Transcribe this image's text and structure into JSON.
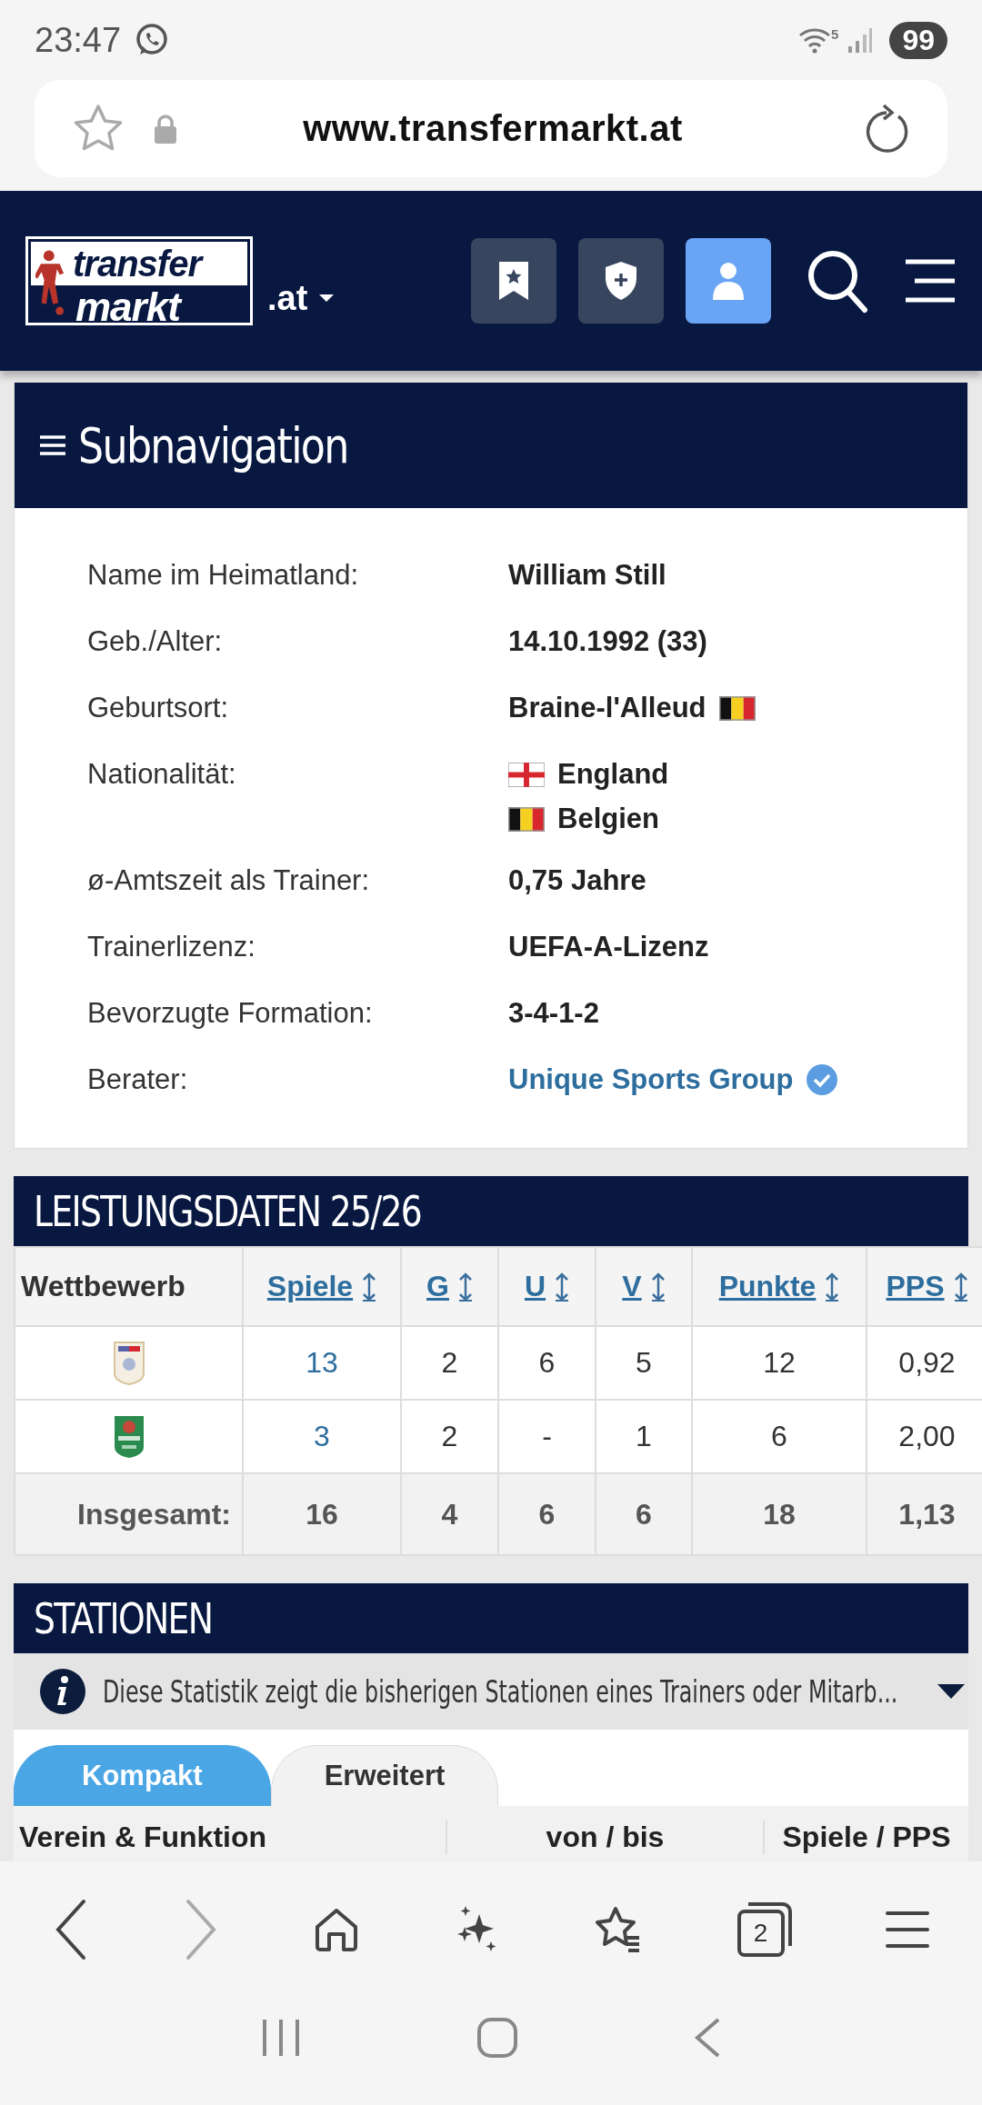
{
  "status_bar": {
    "time": "23:47",
    "wifi_badge": "5",
    "battery": "99"
  },
  "browser": {
    "url": "www.transfermarkt.at"
  },
  "site_header": {
    "logo_top": "transfer",
    "logo_bottom": "markt",
    "domain": ".at",
    "buttons": [
      {
        "kind": "bookmark",
        "active": false
      },
      {
        "kind": "shield",
        "active": false
      },
      {
        "kind": "user",
        "active": true
      }
    ]
  },
  "subnavigation": {
    "title": "Subnavigation"
  },
  "details": [
    {
      "label": "Name im Heimatland:",
      "values": [
        {
          "kind": "plain",
          "text": "William Still"
        }
      ]
    },
    {
      "label": "Geb./Alter:",
      "values": [
        {
          "kind": "plain",
          "text": "14.10.1992 (33)"
        }
      ]
    },
    {
      "label": "Geburtsort:",
      "values": [
        {
          "kind": "belgium_flag_after",
          "text": "Braine-l'Alleud"
        }
      ]
    },
    {
      "label": "Nationalität:",
      "values": [
        {
          "kind": "england_flag_before",
          "text": "England"
        },
        {
          "kind": "belgium_flag_before",
          "text": "Belgien"
        }
      ]
    },
    {
      "label": "ø-Amtszeit als Trainer:",
      "values": [
        {
          "kind": "plain",
          "text": "0,75 Jahre"
        }
      ]
    },
    {
      "label": "Trainerlizenz:",
      "values": [
        {
          "kind": "plain",
          "text": "UEFA-A-Lizenz"
        }
      ]
    },
    {
      "label": "Bevorzugte Formation:",
      "values": [
        {
          "kind": "plain",
          "text": "3-4-1-2"
        }
      ]
    },
    {
      "label": "Berater:",
      "values": [
        {
          "kind": "link",
          "text": "Unique Sports Group",
          "verified": true
        }
      ]
    }
  ],
  "performance": {
    "title": "LEISTUNGSDATEN 25/26",
    "columns": [
      {
        "label": "Wettbewerb",
        "sortable": false
      },
      {
        "label": "Spiele",
        "sortable": true,
        "linked": true
      },
      {
        "label": "G",
        "sortable": true,
        "linked": false
      },
      {
        "label": "U",
        "sortable": true,
        "linked": false
      },
      {
        "label": "V",
        "sortable": true,
        "linked": false
      },
      {
        "label": "Punkte",
        "sortable": true,
        "linked": false
      },
      {
        "label": "PPS",
        "sortable": true,
        "linked": false
      }
    ],
    "rows": [
      {
        "kind": "league",
        "cells": [
          "",
          "13",
          "2",
          "6",
          "5",
          "12",
          "0,92"
        ]
      },
      {
        "kind": "cup",
        "cells": [
          "",
          "3",
          "2",
          "-",
          "1",
          "6",
          "2,00"
        ]
      }
    ],
    "total": {
      "cells": [
        "Insgesamt:",
        "16",
        "4",
        "6",
        "6",
        "18",
        "1,13"
      ]
    }
  },
  "stations": {
    "title": "STATIONEN",
    "info": "Diese Statistik zeigt die bisherigen Stationen eines Trainers oder Mitarb...",
    "info_expanded": false,
    "tabs": [
      {
        "label": "Kompakt",
        "selected": true
      },
      {
        "label": "Erweitert",
        "selected": false
      }
    ],
    "columns": [
      "Verein & Funktion",
      "von / bis",
      "Spiele / PPS"
    ]
  },
  "bottom_bar": {
    "forward_disabled": true,
    "tab_count": "2"
  }
}
